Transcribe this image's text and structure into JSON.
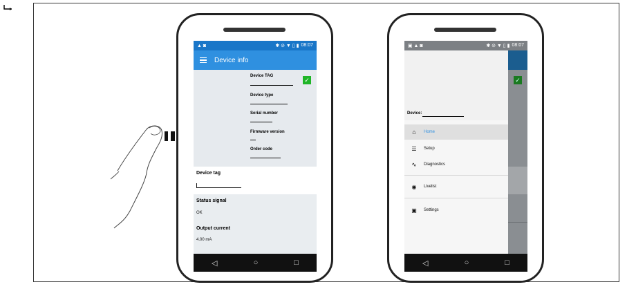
{
  "left_phone": {
    "status_time": "08:07",
    "status_left": "▲ ◙",
    "status_right": "✱ ⊘ ▼ ▯ ▮",
    "appbar_title": "Device info",
    "info_labels": [
      "Device TAG",
      "Device type",
      "Serial number",
      "Firmware version",
      "Order code"
    ],
    "device_tag_label": "Device tag",
    "status_signal_label": "Status signal",
    "status_signal_value": "OK",
    "output_current_label": "Output current",
    "output_current_value": "4.00 mA"
  },
  "right_phone": {
    "status_time": "08:07",
    "status_left": "▣ ▲ ◙",
    "status_right": "✱ ⊘ ▼ ▯ ▮",
    "device_label": "Device:",
    "menu": [
      {
        "label": "Home",
        "icon": "home-icon",
        "glyph": "⌂"
      },
      {
        "label": "Setup",
        "icon": "sliders-icon",
        "glyph": "☰"
      },
      {
        "label": "Diagnostics",
        "icon": "pulse-icon",
        "glyph": "∿"
      },
      {
        "label": "Livelist",
        "icon": "broadcast-icon",
        "glyph": "◉"
      },
      {
        "label": "Settings",
        "icon": "settings-icon",
        "glyph": "▣"
      }
    ]
  },
  "nav": {
    "back": "◁",
    "home": "○",
    "recent": "□"
  },
  "colors": {
    "accent": "#2f90e0",
    "check": "#1fb527",
    "nav": "#111111"
  }
}
